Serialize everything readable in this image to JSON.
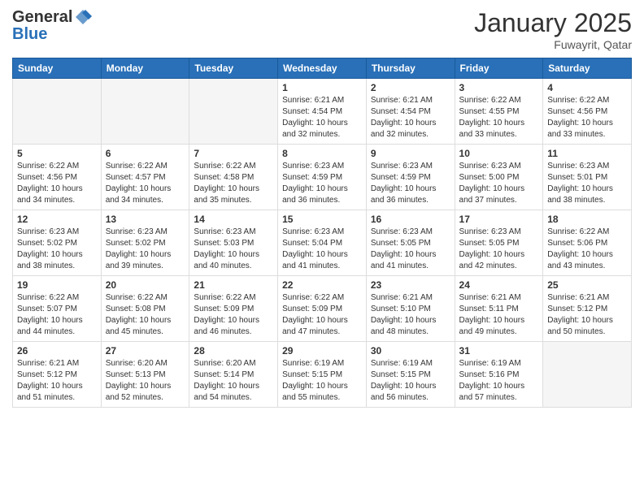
{
  "header": {
    "logo_general": "General",
    "logo_blue": "Blue",
    "month_title": "January 2025",
    "location": "Fuwayrit, Qatar"
  },
  "weekdays": [
    "Sunday",
    "Monday",
    "Tuesday",
    "Wednesday",
    "Thursday",
    "Friday",
    "Saturday"
  ],
  "weeks": [
    [
      {
        "day": "",
        "info": ""
      },
      {
        "day": "",
        "info": ""
      },
      {
        "day": "",
        "info": ""
      },
      {
        "day": "1",
        "info": "Sunrise: 6:21 AM\nSunset: 4:54 PM\nDaylight: 10 hours\nand 32 minutes."
      },
      {
        "day": "2",
        "info": "Sunrise: 6:21 AM\nSunset: 4:54 PM\nDaylight: 10 hours\nand 32 minutes."
      },
      {
        "day": "3",
        "info": "Sunrise: 6:22 AM\nSunset: 4:55 PM\nDaylight: 10 hours\nand 33 minutes."
      },
      {
        "day": "4",
        "info": "Sunrise: 6:22 AM\nSunset: 4:56 PM\nDaylight: 10 hours\nand 33 minutes."
      }
    ],
    [
      {
        "day": "5",
        "info": "Sunrise: 6:22 AM\nSunset: 4:56 PM\nDaylight: 10 hours\nand 34 minutes."
      },
      {
        "day": "6",
        "info": "Sunrise: 6:22 AM\nSunset: 4:57 PM\nDaylight: 10 hours\nand 34 minutes."
      },
      {
        "day": "7",
        "info": "Sunrise: 6:22 AM\nSunset: 4:58 PM\nDaylight: 10 hours\nand 35 minutes."
      },
      {
        "day": "8",
        "info": "Sunrise: 6:23 AM\nSunset: 4:59 PM\nDaylight: 10 hours\nand 36 minutes."
      },
      {
        "day": "9",
        "info": "Sunrise: 6:23 AM\nSunset: 4:59 PM\nDaylight: 10 hours\nand 36 minutes."
      },
      {
        "day": "10",
        "info": "Sunrise: 6:23 AM\nSunset: 5:00 PM\nDaylight: 10 hours\nand 37 minutes."
      },
      {
        "day": "11",
        "info": "Sunrise: 6:23 AM\nSunset: 5:01 PM\nDaylight: 10 hours\nand 38 minutes."
      }
    ],
    [
      {
        "day": "12",
        "info": "Sunrise: 6:23 AM\nSunset: 5:02 PM\nDaylight: 10 hours\nand 38 minutes."
      },
      {
        "day": "13",
        "info": "Sunrise: 6:23 AM\nSunset: 5:02 PM\nDaylight: 10 hours\nand 39 minutes."
      },
      {
        "day": "14",
        "info": "Sunrise: 6:23 AM\nSunset: 5:03 PM\nDaylight: 10 hours\nand 40 minutes."
      },
      {
        "day": "15",
        "info": "Sunrise: 6:23 AM\nSunset: 5:04 PM\nDaylight: 10 hours\nand 41 minutes."
      },
      {
        "day": "16",
        "info": "Sunrise: 6:23 AM\nSunset: 5:05 PM\nDaylight: 10 hours\nand 41 minutes."
      },
      {
        "day": "17",
        "info": "Sunrise: 6:23 AM\nSunset: 5:05 PM\nDaylight: 10 hours\nand 42 minutes."
      },
      {
        "day": "18",
        "info": "Sunrise: 6:22 AM\nSunset: 5:06 PM\nDaylight: 10 hours\nand 43 minutes."
      }
    ],
    [
      {
        "day": "19",
        "info": "Sunrise: 6:22 AM\nSunset: 5:07 PM\nDaylight: 10 hours\nand 44 minutes."
      },
      {
        "day": "20",
        "info": "Sunrise: 6:22 AM\nSunset: 5:08 PM\nDaylight: 10 hours\nand 45 minutes."
      },
      {
        "day": "21",
        "info": "Sunrise: 6:22 AM\nSunset: 5:09 PM\nDaylight: 10 hours\nand 46 minutes."
      },
      {
        "day": "22",
        "info": "Sunrise: 6:22 AM\nSunset: 5:09 PM\nDaylight: 10 hours\nand 47 minutes."
      },
      {
        "day": "23",
        "info": "Sunrise: 6:21 AM\nSunset: 5:10 PM\nDaylight: 10 hours\nand 48 minutes."
      },
      {
        "day": "24",
        "info": "Sunrise: 6:21 AM\nSunset: 5:11 PM\nDaylight: 10 hours\nand 49 minutes."
      },
      {
        "day": "25",
        "info": "Sunrise: 6:21 AM\nSunset: 5:12 PM\nDaylight: 10 hours\nand 50 minutes."
      }
    ],
    [
      {
        "day": "26",
        "info": "Sunrise: 6:21 AM\nSunset: 5:12 PM\nDaylight: 10 hours\nand 51 minutes."
      },
      {
        "day": "27",
        "info": "Sunrise: 6:20 AM\nSunset: 5:13 PM\nDaylight: 10 hours\nand 52 minutes."
      },
      {
        "day": "28",
        "info": "Sunrise: 6:20 AM\nSunset: 5:14 PM\nDaylight: 10 hours\nand 54 minutes."
      },
      {
        "day": "29",
        "info": "Sunrise: 6:19 AM\nSunset: 5:15 PM\nDaylight: 10 hours\nand 55 minutes."
      },
      {
        "day": "30",
        "info": "Sunrise: 6:19 AM\nSunset: 5:15 PM\nDaylight: 10 hours\nand 56 minutes."
      },
      {
        "day": "31",
        "info": "Sunrise: 6:19 AM\nSunset: 5:16 PM\nDaylight: 10 hours\nand 57 minutes."
      },
      {
        "day": "",
        "info": ""
      }
    ]
  ]
}
